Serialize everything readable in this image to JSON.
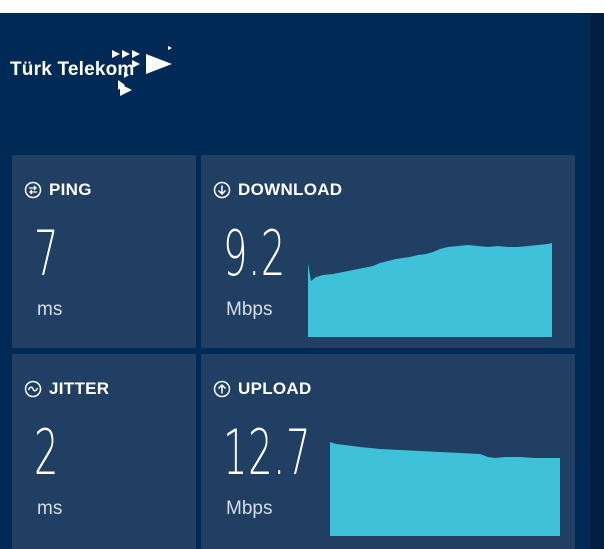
{
  "brand": {
    "name": "Türk Telekom"
  },
  "metrics": {
    "ping": {
      "label": "PING",
      "value": "7",
      "unit": "ms",
      "icon": "ping-icon"
    },
    "download": {
      "label": "DOWNLOAD",
      "value": "9.2",
      "unit": "Mbps",
      "icon": "download-arrow-icon"
    },
    "jitter": {
      "label": "JITTER",
      "value": "2",
      "unit": "ms",
      "icon": "jitter-icon"
    },
    "upload": {
      "label": "UPLOAD",
      "value": "12.7",
      "unit": "Mbps",
      "icon": "upload-arrow-icon"
    }
  },
  "colors": {
    "background": "#002a56",
    "card": "#203f63",
    "graph_fill": "#3dc2d9",
    "text": "#ffffff"
  }
}
